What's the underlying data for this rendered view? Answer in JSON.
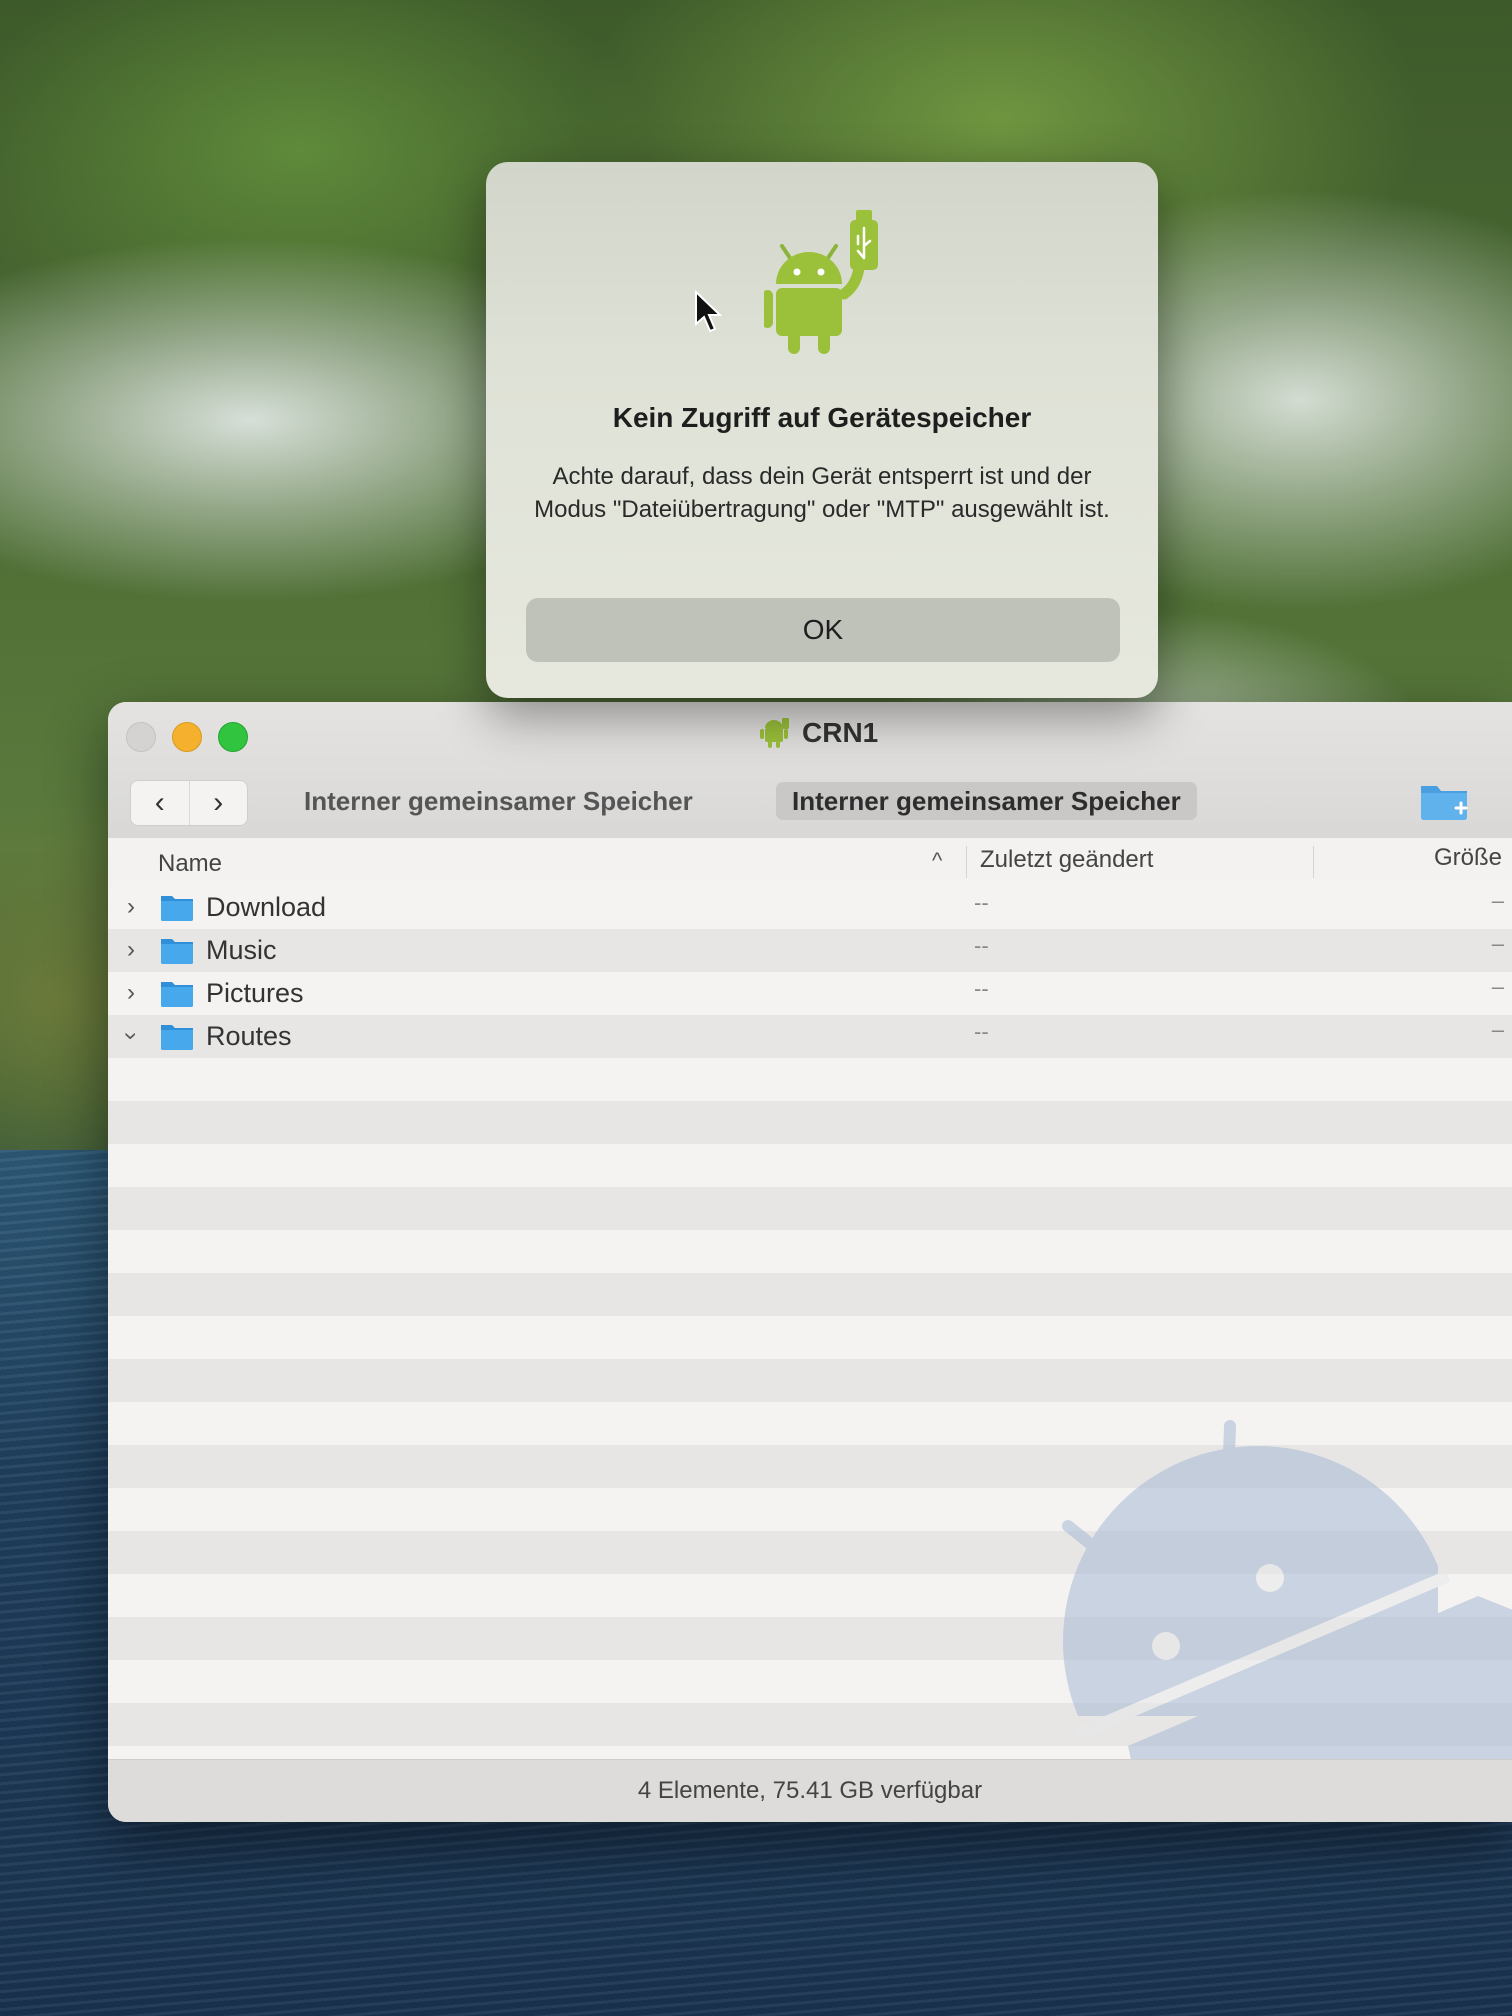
{
  "alert": {
    "title": "Kein Zugriff auf Gerätespeicher",
    "message": "Achte darauf, dass dein Gerät entsperrt ist und der Modus \"Dateiübertragung\" oder \"MTP\" ausgewählt ist.",
    "ok_label": "OK",
    "icon": "android-usb-icon"
  },
  "window": {
    "title": "CRN1",
    "breadcrumbs": [
      "Interner gemeinsamer Speicher",
      "Interner gemeinsamer Speicher"
    ],
    "nav": {
      "back": "‹",
      "forward": "›"
    },
    "columns": {
      "name": "Name",
      "modified": "Zuletzt geändert",
      "size": "Größe",
      "sort_indicator": "^"
    },
    "rows": [
      {
        "name": "Download",
        "modified": "--",
        "size": "–",
        "expanded": false
      },
      {
        "name": "Music",
        "modified": "--",
        "size": "–",
        "expanded": false
      },
      {
        "name": "Pictures",
        "modified": "--",
        "size": "–",
        "expanded": false
      },
      {
        "name": "Routes",
        "modified": "--",
        "size": "–",
        "expanded": true
      }
    ],
    "status": "4 Elemente, 75.41 GB verfügbar"
  },
  "colors": {
    "android_green": "#9bc13a",
    "folder_blue": "#3fa3e8",
    "traffic_minimize": "#f5b12e",
    "traffic_maximize": "#30c43f"
  }
}
